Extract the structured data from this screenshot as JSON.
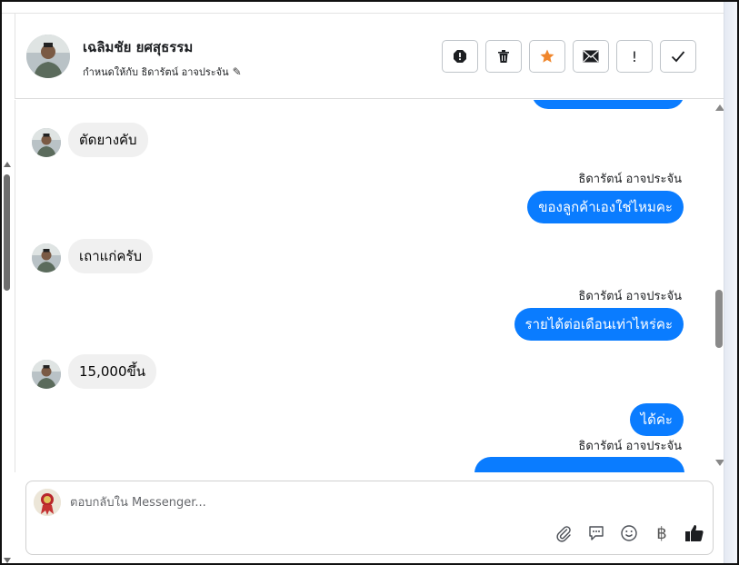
{
  "header": {
    "contact_name": "เฉลิมชัย ยศสุธรรม",
    "assigned_to": "กำหนดให้กับ ธิดารัตน์ อาจประจัน",
    "actions": [
      {
        "name": "spam-icon",
        "label": "!"
      },
      {
        "name": "trash-icon",
        "label": ""
      },
      {
        "name": "star-icon",
        "label": ""
      },
      {
        "name": "envelope-icon",
        "label": ""
      },
      {
        "name": "exclamation-icon",
        "label": "!"
      },
      {
        "name": "check-icon",
        "label": ""
      }
    ]
  },
  "messages": [
    {
      "type": "outgoing-partial",
      "text": ""
    },
    {
      "type": "incoming",
      "text": "ตัดยางคับ"
    },
    {
      "type": "outgoing",
      "sender": "ธิดารัตน์ อาจประจัน",
      "text": "ของลูกค้าเองใช่ไหมคะ"
    },
    {
      "type": "incoming",
      "text": "เถาแก่ครับ"
    },
    {
      "type": "outgoing",
      "sender": "ธิดารัตน์ อาจประจัน",
      "text": "รายได้ต่อเดือนเท่าไหร่คะ"
    },
    {
      "type": "incoming",
      "text": "15,000ขึ้น"
    },
    {
      "type": "outgoing",
      "text": "ได้ค่ะ"
    },
    {
      "type": "outgoing-partial",
      "sender": "ธิดารัตน์ อาจประจัน",
      "text": ""
    }
  ],
  "composer": {
    "placeholder": "ตอบกลับใน Messenger...",
    "tools": [
      "paperclip-icon",
      "chat-bubble-icon",
      "emoji-icon",
      "baht-icon",
      "thumbs-up-icon"
    ],
    "baht_symbol": "฿"
  },
  "colors": {
    "outgoing_bubble": "#0a7cff",
    "incoming_bubble": "#f0f0f0",
    "star": "#f0862c"
  }
}
